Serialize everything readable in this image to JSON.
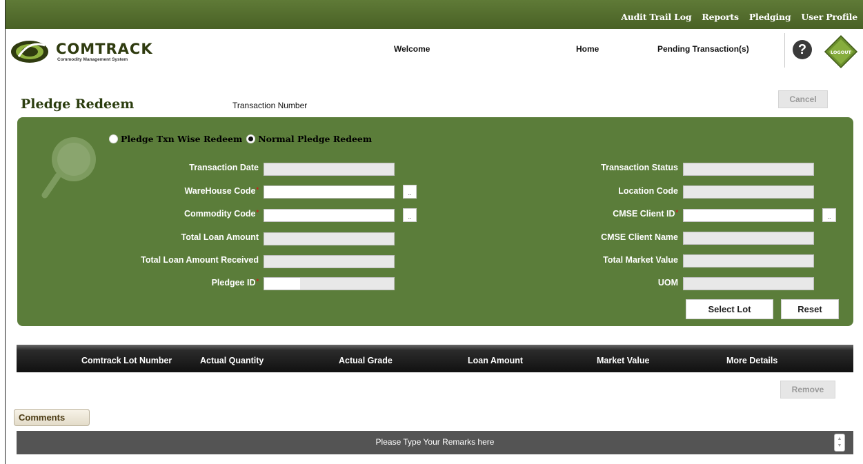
{
  "topnav": [
    "Audit Trail Log",
    "Reports",
    "Pledging",
    "User Profile"
  ],
  "logo": {
    "name": "COMTRACK",
    "tagline": "Commodity Management System"
  },
  "header": {
    "welcome": "Welcome",
    "home": "Home",
    "pending": "Pending Transaction(s)",
    "help": "?",
    "logout": "LOGOUT"
  },
  "page": {
    "title": "Pledge Redeem",
    "txn_label": "Transaction Number",
    "cancel": "Cancel"
  },
  "radios": [
    {
      "label": "Pledge Txn Wise Redeem",
      "checked": false
    },
    {
      "label": "Normal Pledge Redeem",
      "checked": true
    }
  ],
  "form": {
    "transaction_date": "Transaction Date",
    "warehouse_code": "WareHouse Code",
    "commodity_code": "Commodity Code",
    "total_loan_amount": "Total Loan Amount",
    "total_loan_received": "Total Loan Amount Received",
    "pledgee_id": "Pledgee ID",
    "transaction_status": "Transaction Status",
    "location_code": "Location Code",
    "cmse_client_id": "CMSE Client ID",
    "cmse_client_name": "CMSE Client Name",
    "total_market_value": "Total Market Value",
    "uom": "UOM",
    "required_mark": "*",
    "lookup": ".."
  },
  "buttons": {
    "select_lot": "Select Lot",
    "reset": "Reset",
    "remove": "Remove",
    "comments": "Comments"
  },
  "table": {
    "columns": [
      "Comtrack Lot Number",
      "Actual Quantity",
      "Actual Grade",
      "Loan Amount",
      "Market Value",
      "More Details"
    ]
  },
  "remarks_placeholder": "Please Type Your Remarks here",
  "colors": {
    "brand_green": "#5b7d3a",
    "topbar": "#536d2e",
    "dark_bar": "#111111"
  }
}
